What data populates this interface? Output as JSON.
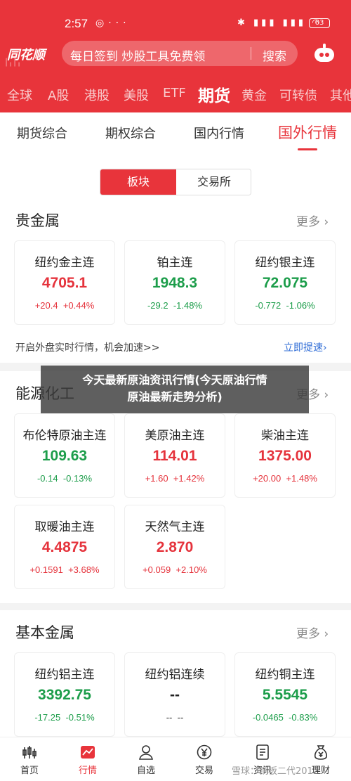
{
  "status": {
    "time": "2:57",
    "battery": "63"
  },
  "header": {
    "logo": "同花顺",
    "search_placeholder": "每日签到 炒股工具免费领",
    "search_button": "搜索"
  },
  "top_tabs": [
    "全球",
    "A股",
    "港股",
    "美股",
    "ETF",
    "期货",
    "黄金",
    "可转债",
    "其他"
  ],
  "top_tab_active": "期货",
  "sub_tabs": [
    "期货综合",
    "期权综合",
    "国内行情",
    "国外行情"
  ],
  "sub_tab_active": "国外行情",
  "segment": {
    "left": "板块",
    "right": "交易所"
  },
  "sections": [
    {
      "title": "贵金属",
      "more": "更多",
      "cards": [
        {
          "name": "纽约金主连",
          "price": "4705.1",
          "change": "+20.4",
          "pct": "+0.44%",
          "dir": "up"
        },
        {
          "name": "铂主连",
          "price": "1948.3",
          "change": "-29.2",
          "pct": "-1.48%",
          "dir": "dn"
        },
        {
          "name": "纽约银主连",
          "price": "72.075",
          "change": "-0.772",
          "pct": "-1.06%",
          "dir": "dn"
        }
      ]
    },
    {
      "title": "能源化工",
      "more": "更多",
      "cards": [
        {
          "name": "布伦特原油主连",
          "price": "109.63",
          "change": "-0.14",
          "pct": "-0.13%",
          "dir": "dn"
        },
        {
          "name": "美原油主连",
          "price": "114.01",
          "change": "+1.60",
          "pct": "+1.42%",
          "dir": "up"
        },
        {
          "name": "柴油主连",
          "price": "1375.00",
          "change": "+20.00",
          "pct": "+1.48%",
          "dir": "up"
        },
        {
          "name": "取暖油主连",
          "price": "4.4875",
          "change": "+0.1591",
          "pct": "+3.68%",
          "dir": "up"
        },
        {
          "name": "天然气主连",
          "price": "2.870",
          "change": "+0.059",
          "pct": "+2.10%",
          "dir": "up"
        }
      ]
    },
    {
      "title": "基本金属",
      "more": "更多",
      "cards": [
        {
          "name": "纽约铝主连",
          "price": "3392.75",
          "change": "-17.25",
          "pct": "-0.51%",
          "dir": "dn"
        },
        {
          "name": "纽约铝连续",
          "price": "--",
          "change": "--",
          "pct": "--",
          "dir": "neu"
        },
        {
          "name": "纽约铜主连",
          "price": "5.5545",
          "change": "-0.0465",
          "pct": "-0.83%",
          "dir": "dn"
        }
      ]
    }
  ],
  "promo": {
    "text": "开启外盘实时行情，机会加速>>",
    "link": "立即提速"
  },
  "overlay": {
    "line1": "今天最新原油资讯行情(今天原油行情",
    "line2": "原油最新走势分析)"
  },
  "bottom_nav": [
    "首页",
    "行情",
    "自选",
    "交易",
    "资讯",
    "理财"
  ],
  "bottom_nav_active": "行情",
  "watermark": "雪球：铜板二代2012",
  "colors": {
    "brand": "#e8343b",
    "up": "#e5333c",
    "down": "#1c9d4a"
  }
}
